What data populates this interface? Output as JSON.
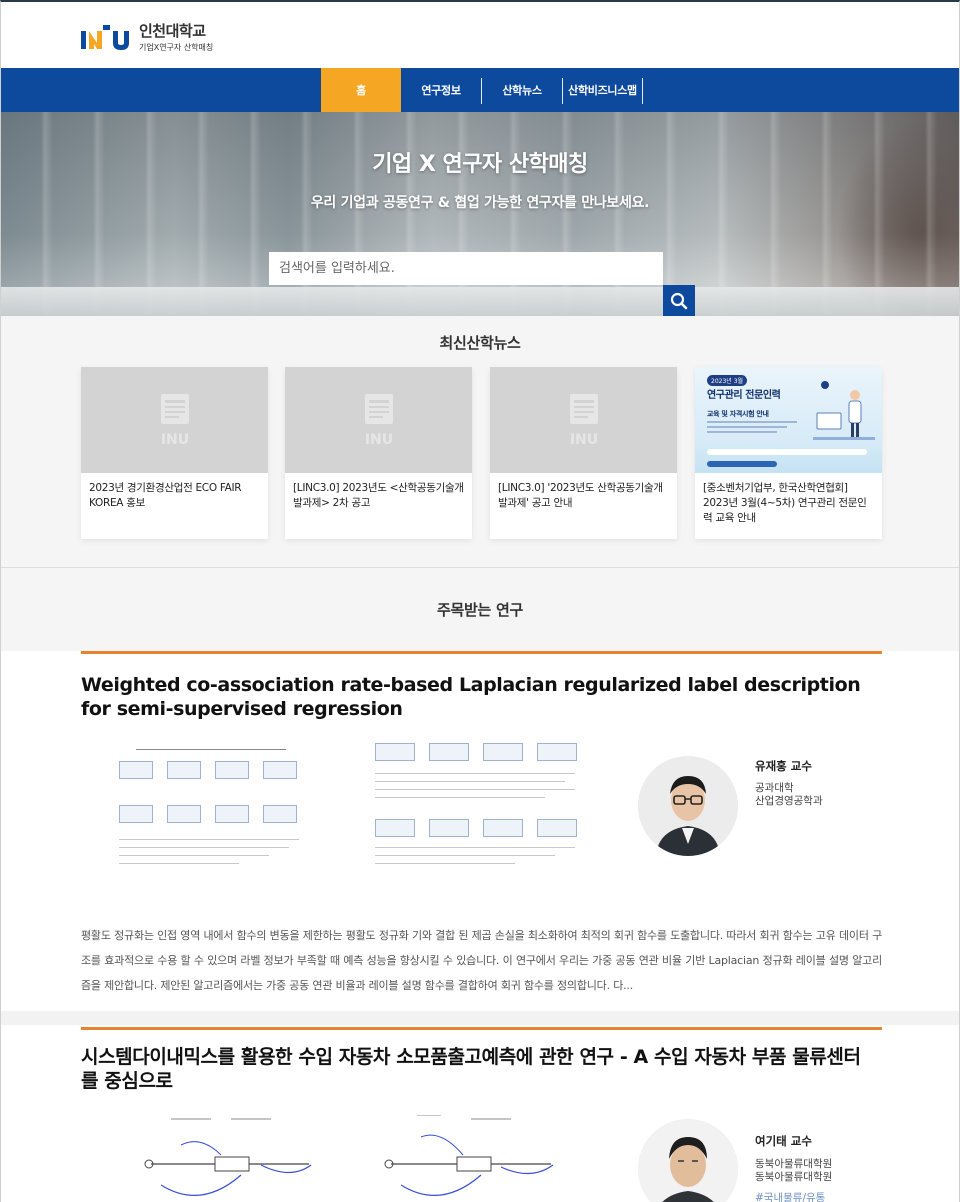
{
  "header": {
    "logo_name": "인천대학교",
    "logo_sub": "기업X연구자 산학매칭"
  },
  "nav": {
    "items": [
      {
        "label": "홈",
        "active": true
      },
      {
        "label": "연구정보",
        "active": false
      },
      {
        "label": "산학뉴스",
        "active": false
      },
      {
        "label": "산학비즈니스맵",
        "active": false
      }
    ]
  },
  "hero": {
    "title": "기업 X 연구자 산학매칭",
    "subtitle": "우리 기업과 공동연구 & 협업 가능한 연구자를 만나보세요.",
    "search_placeholder": "검색어를 입력하세요.",
    "search_icon": "search-icon"
  },
  "news": {
    "title": "최신산학뉴스",
    "cards": [
      {
        "text": "2023년 경기환경산업전 ECO FAIR KOREA 홍보",
        "thumb": "placeholder"
      },
      {
        "text": "[LINC3.0] 2023년도 <산학공동기술개발과제> 2차 공고",
        "thumb": "placeholder"
      },
      {
        "text": "[LINC3.0] '2023년도 산학공동기술개발과제' 공고 안내",
        "thumb": "placeholder"
      },
      {
        "text": "[중소벤처기업부, 한국산학연협회] 2023년 3월(4~5차) 연구관리 전문인력 교육 안내",
        "thumb": "poster"
      }
    ],
    "poster": {
      "badge": "2023년 3월",
      "title": "연구관리 전문인력",
      "subtitle": "교육 및 자격시험 안내"
    }
  },
  "featured": {
    "title": "주목받는 연구",
    "items": [
      {
        "title": "Weighted co-association rate-based Laplacian regularized label description for semi-supervised regression",
        "professor": "유재홍 교수",
        "college": "공과대학",
        "department": "산업경영공학과",
        "abstract": "평활도 정규화는 인접 영역 내에서 함수의 변동을 제한하는 평활도 정규화 기와 결합 된 제곱 손실을 최소화하여 최적의 회귀 함수를 도출합니다. 따라서 회귀 함수는 고유 데이터 구조를 효과적으로 수용 할 수 있으며 라벨 정보가 부족할 때 예측 성능을 향상시킬 수 있습니다. 이 연구에서 우리는 가중 공동 연관 비율 기반 Laplacian 정규화 레이블 설명 알고리즘을 제안합니다. 제안된 알고리즘에서는 가중 공동 연관 비율과 레이블 설명 함수를 결합하여 회귀 함수를 정의합니다. 다..."
      },
      {
        "title": "시스템다이내믹스를 활용한 수입 자동차 소모품출고예측에 관한 연구 - A 수입 자동차 부품 물류센터를 중심으로",
        "professor": "여기태 교수",
        "college": "동북아물류대학원",
        "department": "동북아물류대학원",
        "tag": "#국내물류/유통"
      }
    ]
  }
}
